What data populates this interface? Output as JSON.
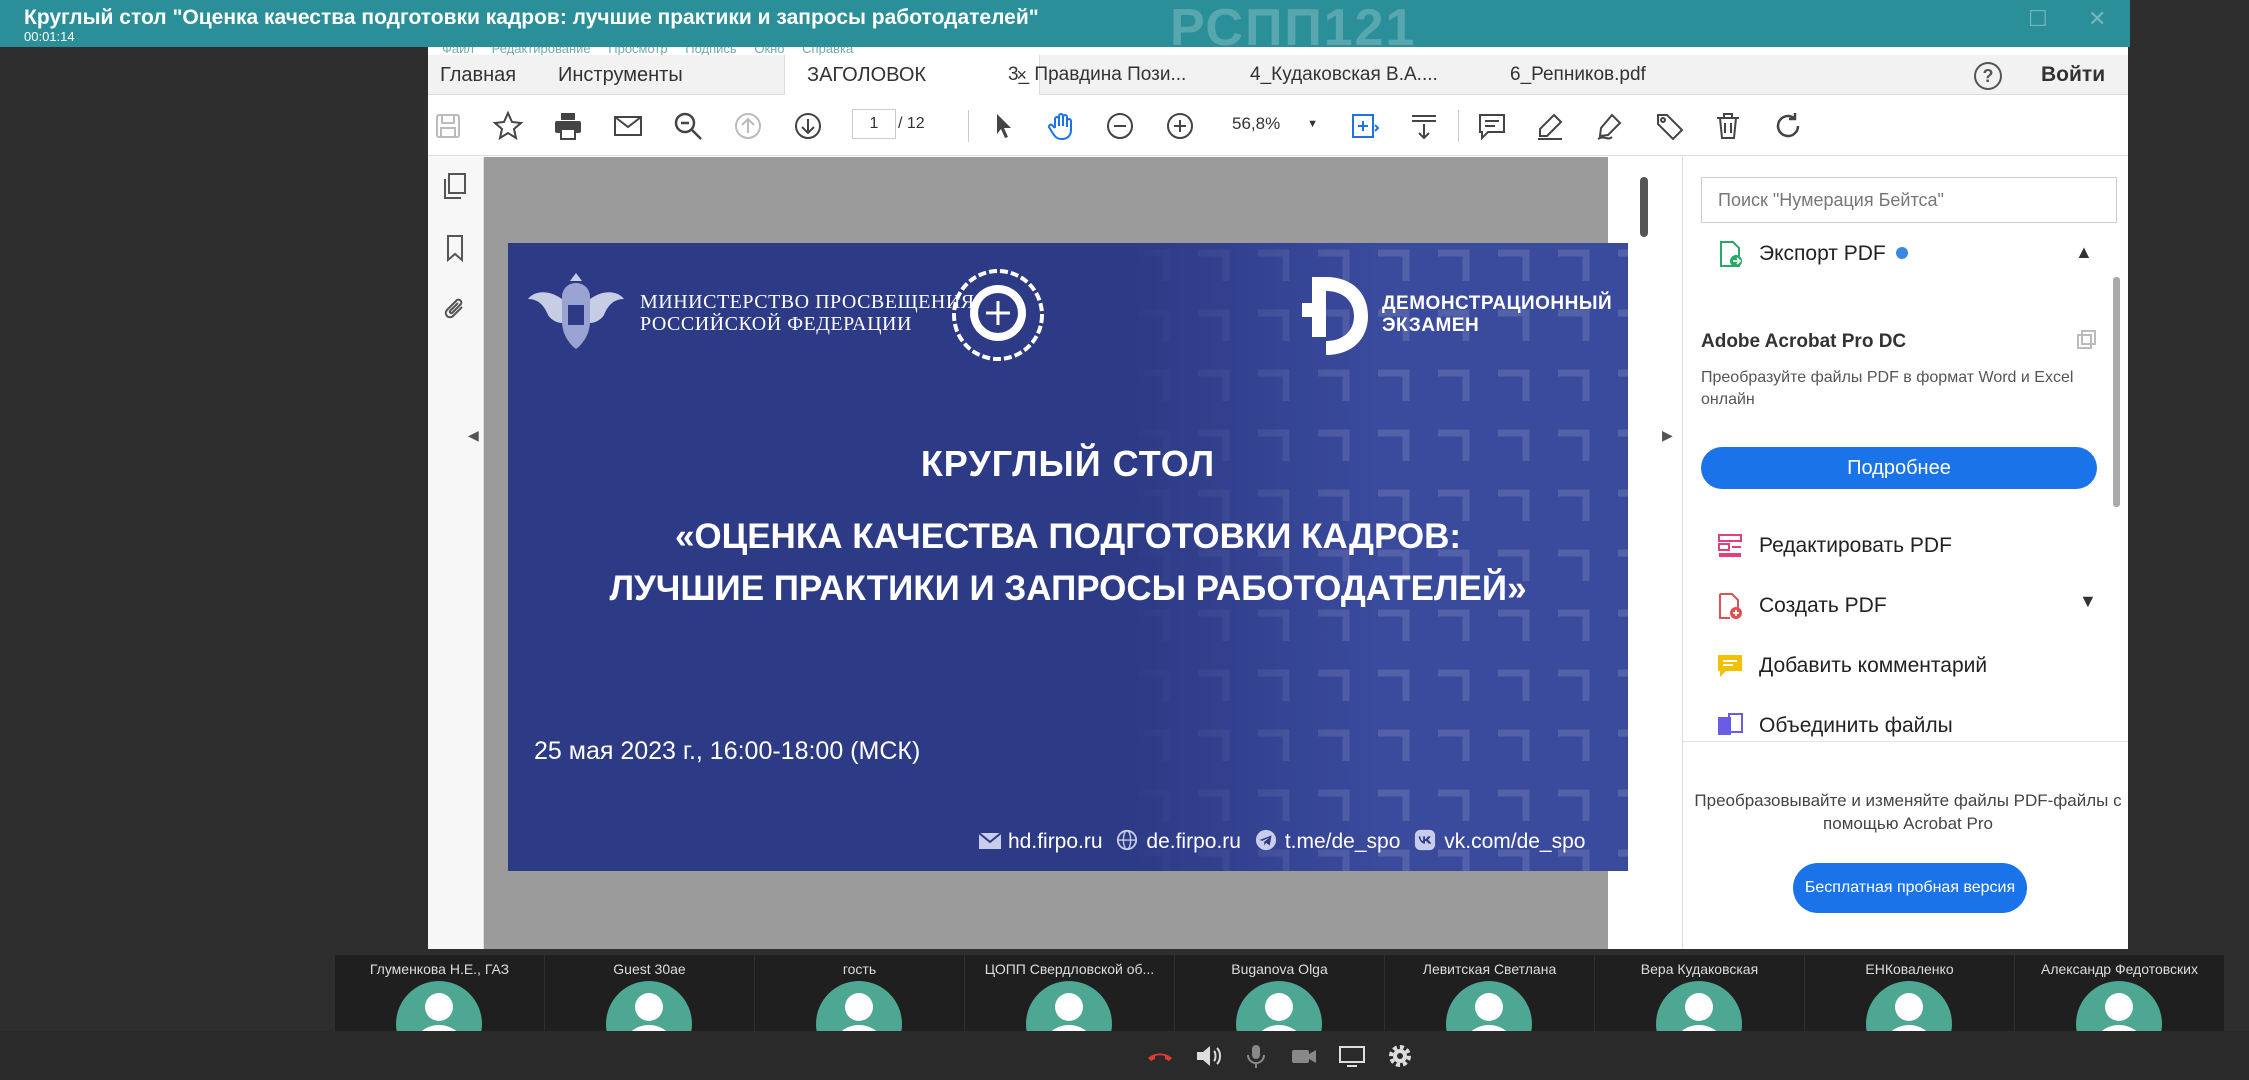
{
  "meeting": {
    "title": "Круглый стол \"Оценка качества подготовки кадров: лучшие практики и запросы работодателей\"",
    "timer": "00:01:14",
    "watermark": "РСПП121"
  },
  "menubar": [
    "Файл",
    "Редактирование",
    "Просмотр",
    "Подпись",
    "Окно",
    "Справка"
  ],
  "tabs": {
    "home": "Главная",
    "tools": "Инструменты",
    "active": "ЗАГОЛОВОК",
    "close": "×",
    "docs": [
      "3_ Правдина Пози...",
      "4_Кудаковская В.А....",
      "6_Репников.pdf"
    ],
    "signin": "Войти",
    "help": "?"
  },
  "toolbar": {
    "page_current": "1",
    "page_total": "/ 12",
    "zoom": "56,8%"
  },
  "slide": {
    "ministry": "МИНИСТЕРСТВО ПРОСВЕЩЕНИЯ\nРОССИЙСКОЙ ФЕДЕРАЦИИ",
    "demo_line1": "ДЕМОНСТРАЦИОННЫЙ",
    "demo_line2": "ЭКЗАМЕН",
    "heading": "КРУГЛЫЙ СТОЛ",
    "subheading_line1": "«ОЦЕНКА КАЧЕСТВА ПОДГОТОВКИ КАДРОВ:",
    "subheading_line2": "ЛУЧШИЕ ПРАКТИКИ И ЗАПРОСЫ РАБОТОДАТЕЛЕЙ»",
    "date": "25 мая 2023 г., 16:00-18:00 (МСК)",
    "links": [
      "hd.firpo.ru",
      "de.firpo.ru",
      "t.me/de_spo",
      "vk.com/de_spo"
    ]
  },
  "right_panel": {
    "search_placeholder": "Поиск \"Нумерация Бейтса\"",
    "export": "Экспорт PDF",
    "acrobat_title": "Adobe Acrobat Pro DC",
    "acrobat_desc": "Преобразуйте файлы PDF в формат Word и Excel онлайн",
    "more_button": "Подробнее",
    "items": [
      "Редактировать PDF",
      "Создать PDF",
      "Добавить комментарий",
      "Объединить файлы"
    ],
    "promo": "Преобразовывайте и изменяйте файлы PDF-файлы с помощью Acrobat Pro",
    "trial_button": "Бесплатная пробная версия"
  },
  "participants": [
    "Глуменкова Н.Е., ГАЗ",
    "Guest 30ae",
    "гость",
    "ЦОПП Свердловской об...",
    "Buganova Olga",
    "Левитская Светлана",
    "Вера Кудаковская",
    "ЕНКоваленко",
    "Александр Федотовских"
  ],
  "colors": {
    "header": "#2a8f98",
    "slide_bg": "#2d3a86",
    "accent_blue": "#1a73e8",
    "avatar": "#4ea792",
    "hangup": "#e53935"
  }
}
